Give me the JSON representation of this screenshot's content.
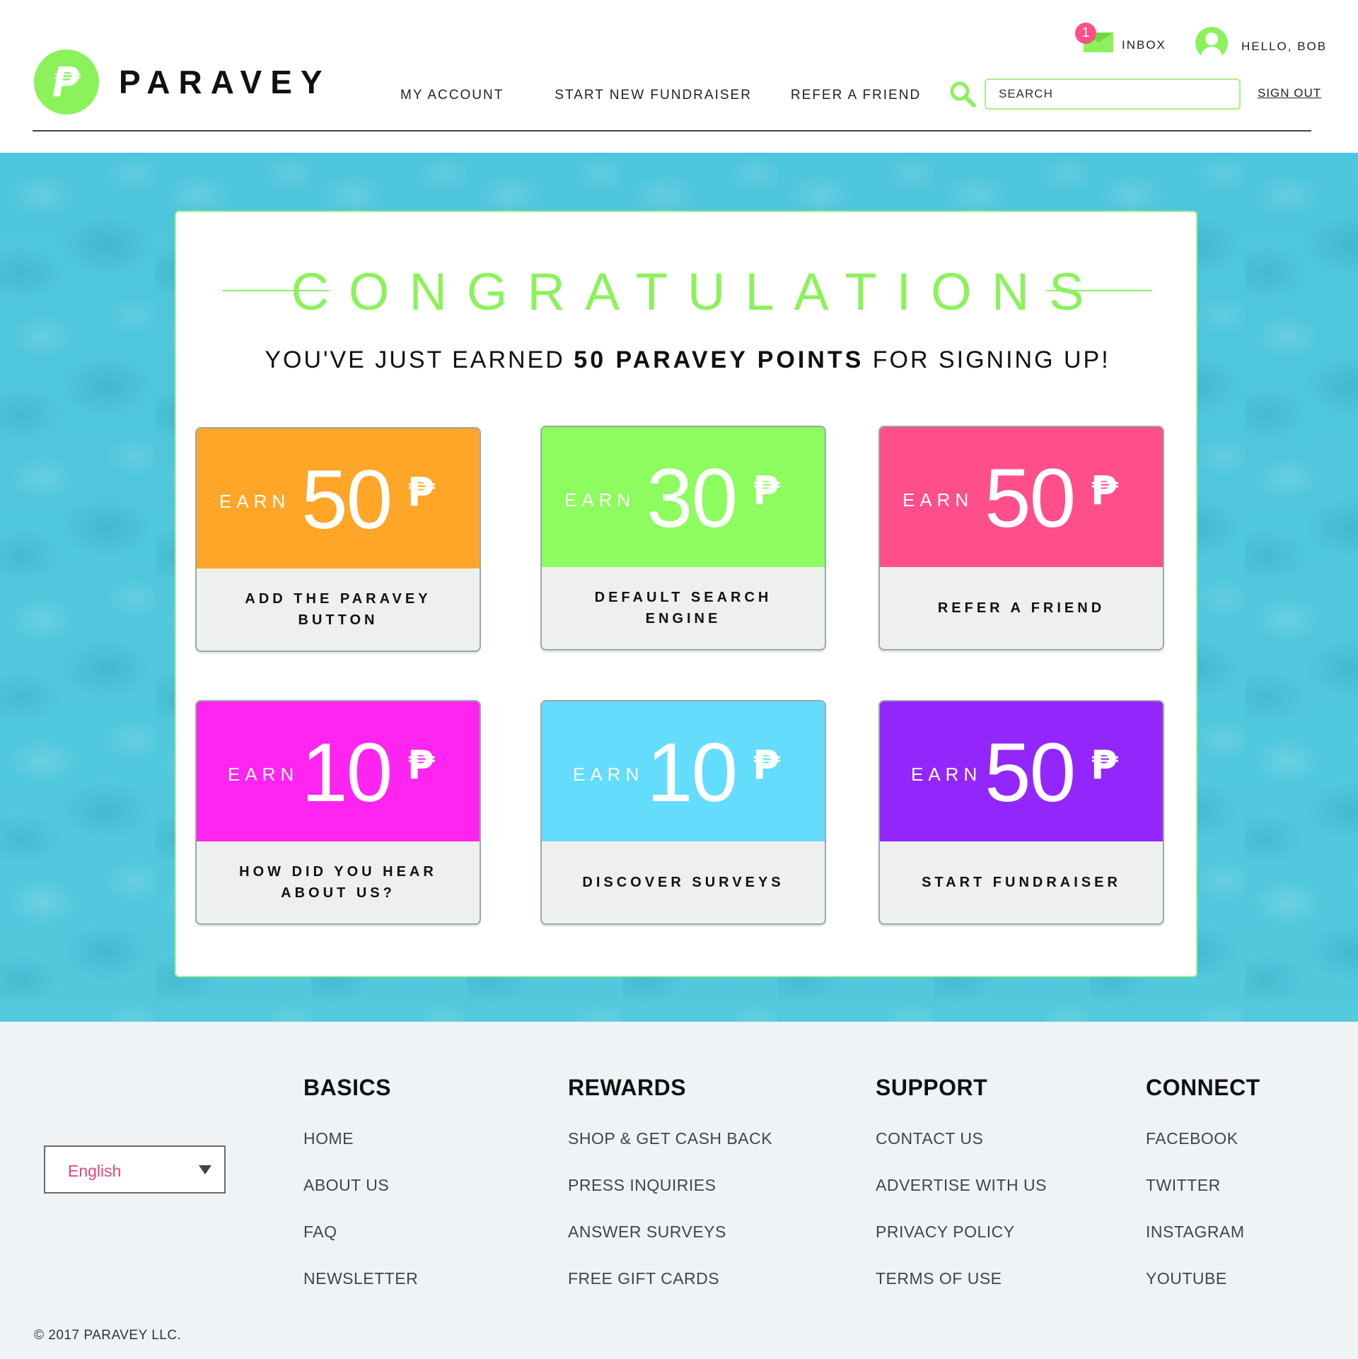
{
  "header": {
    "logo_mark": "₱",
    "brand": "PARAVEY",
    "nav": [
      "MY ACCOUNT",
      "START NEW FUNDRAISER",
      "REFER A FRIEND"
    ],
    "search_placeholder": "SEARCH",
    "sign_out": "SIGN OUT",
    "inbox_count": "1",
    "inbox_label": "INBOX",
    "greeting": "HELLO, BOB"
  },
  "hero": {
    "title": "CONGRATULATIONS",
    "subtitle_pre": "YOU'VE JUST EARNED",
    "subtitle_bold": "50 PARAVEY POINTS",
    "subtitle_post": "FOR SIGNING UP!",
    "tiles": [
      {
        "earn": "EARN",
        "points": "50",
        "currency": "₱",
        "label": "ADD THE PARAVEY BUTTON",
        "color": "#ffa629"
      },
      {
        "earn": "EARN",
        "points": "30",
        "currency": "₱",
        "label": "DEFAULT SEARCH ENGINE",
        "color": "#8cfc5f"
      },
      {
        "earn": "EARN",
        "points": "50",
        "currency": "₱",
        "label": "REFER A FRIEND",
        "color": "#ff4f8a"
      },
      {
        "earn": "EARN",
        "points": "10",
        "currency": "₱",
        "label": "HOW DID YOU HEAR ABOUT US?",
        "color": "#ff24ef"
      },
      {
        "earn": "EARN",
        "points": "10",
        "currency": "₱",
        "label": "DISCOVER SURVEYS",
        "color": "#64dcfb"
      },
      {
        "earn": "EARN",
        "points": "50",
        "currency": "₱",
        "label": "START FUNDRAISER",
        "color": "#9327fb"
      }
    ]
  },
  "footer": {
    "language": "English",
    "columns": [
      {
        "title": "BASICS",
        "links": [
          "HOME",
          "ABOUT US",
          "FAQ",
          "NEWSLETTER"
        ]
      },
      {
        "title": "REWARDS",
        "links": [
          "SHOP & GET CASH BACK",
          "PRESS INQUIRIES",
          "ANSWER SURVEYS",
          "FREE GIFT CARDS"
        ]
      },
      {
        "title": "SUPPORT",
        "links": [
          "CONTACT US",
          "ADVERTISE WITH US",
          "PRIVACY POLICY",
          "TERMS OF USE"
        ]
      },
      {
        "title": "CONNECT",
        "links": [
          "FACEBOOK",
          "TWITTER",
          "INSTAGRAM",
          "YOUTUBE"
        ]
      }
    ],
    "copyright": "© 2017  PARAVEY LLC."
  },
  "colors": {
    "brand_green": "#8bf25c",
    "badge_pink": "#ff4f88",
    "hero_bg": "#56c9dc"
  },
  "icons": {
    "search": "search-icon",
    "inbox": "envelope-icon",
    "user": "user-avatar-icon",
    "dropdown": "caret-down-icon"
  }
}
